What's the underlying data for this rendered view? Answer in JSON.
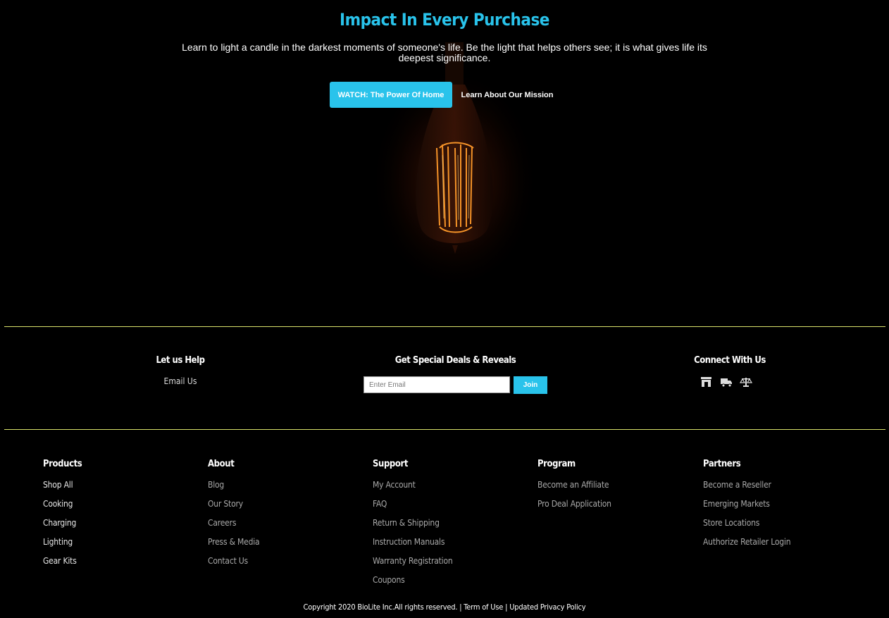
{
  "hero": {
    "title": "Impact In Every Purchase",
    "subtitle": "Learn to light a candle in the darkest moments of someone's life. Be the light that helps others see; it is what gives life its deepest significance.",
    "watch_button": "WATCH: The Power Of Home",
    "mission_link": "Learn About Our Mission"
  },
  "colors": {
    "accent": "#29c3eb",
    "divider": "#d9e26a",
    "background": "#000000"
  },
  "help": {
    "heading": "Let us Help",
    "email_link": "Email Us"
  },
  "newsletter": {
    "heading": "Get Special Deals & Reveals",
    "placeholder": "Enter Email",
    "join_label": "Join"
  },
  "connect": {
    "heading": "Connect With Us",
    "icons": [
      "store-icon",
      "truck-icon",
      "scale-icon"
    ]
  },
  "footer": {
    "columns": [
      {
        "title": "Products",
        "links": [
          "Shop All",
          "Cooking",
          "Charging",
          "Lighting",
          "Gear Kits"
        ]
      },
      {
        "title": "About",
        "links": [
          "Blog",
          "Our Story",
          "Careers",
          "Press & Media",
          "Contact Us"
        ]
      },
      {
        "title": "Support",
        "links": [
          "My Account",
          "FAQ",
          "Return & Shipping",
          "Instruction Manuals",
          "Warranty Registration",
          "Coupons"
        ]
      },
      {
        "title": "Program",
        "links": [
          "Become an Affiliate",
          "Pro Deal Application"
        ]
      },
      {
        "title": "Partners",
        "links": [
          "Become a Reseller",
          "Emerging Markets",
          "Store Locations",
          "Authorize Retailer Login"
        ]
      }
    ],
    "copyright": "Copyright 2020 BioLite Inc.All rights reserved. | Term of Use | Updated Privacy Policy"
  }
}
